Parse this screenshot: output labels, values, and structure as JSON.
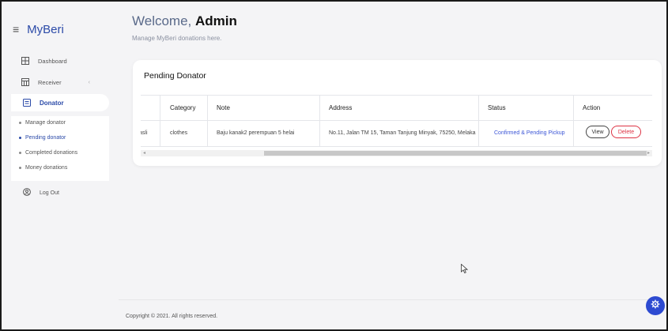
{
  "brand": {
    "menu_glyph": "≡",
    "title": "MyBeri"
  },
  "sidebar": {
    "items": [
      {
        "label": "Dashboard",
        "icon": "grid-icon"
      },
      {
        "label": "Receiver",
        "icon": "table-icon",
        "chevron": "‹"
      },
      {
        "label": "Donator",
        "icon": "list-icon"
      }
    ],
    "subitems": [
      {
        "label": "Manage donator"
      },
      {
        "label": "Pending donator"
      },
      {
        "label": "Completed donations"
      },
      {
        "label": "Money donations"
      }
    ],
    "logout": {
      "label": "Log Out",
      "icon": "user-circle-icon"
    }
  },
  "header": {
    "welcome_prefix": "Welcome,",
    "welcome_name": "Admin",
    "subtitle": "Manage MyBeri donations here."
  },
  "card": {
    "title": "Pending Donator",
    "columns": [
      "Category",
      "Note",
      "Address",
      "Status",
      "Action"
    ],
    "rows": [
      {
        "clipped": "asli",
        "category": "clothes",
        "note": "Baju kanak2 perempuan 5 helai",
        "address": "No.11, Jalan TM 15, Taman Tanjung Minyak, 75250, Melaka",
        "status": "Confirmed & Pending Pickup",
        "view_label": "View",
        "delete_label": "Delete"
      }
    ],
    "scroll_left": "◂",
    "scroll_right": "▸"
  },
  "footer": {
    "copyright": "Copyright © 2021. All rights reserved."
  },
  "colors": {
    "accent": "#2b4aa8",
    "status": "#3b55d6",
    "danger": "#dd3344",
    "fab": "#2d4ad1"
  }
}
